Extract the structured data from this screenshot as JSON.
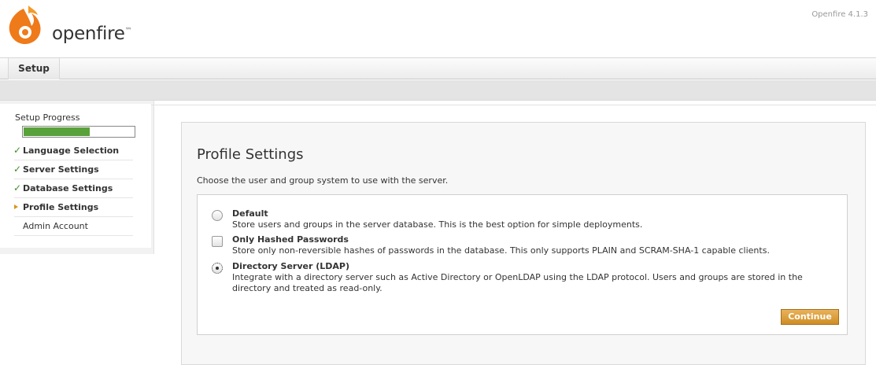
{
  "header": {
    "logo_text": "openfire",
    "logo_tm": "™",
    "version": "Openfire 4.1.3"
  },
  "tabs": {
    "setup_label": "Setup"
  },
  "sidebar": {
    "progress_label": "Setup Progress",
    "progress_fraction": 0.6,
    "items": [
      {
        "label": "Language Selection",
        "state": "done"
      },
      {
        "label": "Server Settings",
        "state": "done"
      },
      {
        "label": "Database Settings",
        "state": "done"
      },
      {
        "label": "Profile Settings",
        "state": "current"
      },
      {
        "label": "Admin Account",
        "state": "pending"
      }
    ]
  },
  "main": {
    "title": "Profile Settings",
    "intro": "Choose the user and group system to use with the server.",
    "options": [
      {
        "title": "Default",
        "description": "Store users and groups in the server database. This is the best option for simple deployments.",
        "selected": false
      },
      {
        "title": "Only Hashed Passwords",
        "description": "Store only non-reversible hashes of passwords in the database. This only supports PLAIN and SCRAM-SHA-1 capable clients.",
        "selected": false
      },
      {
        "title": "Directory Server (LDAP)",
        "description": "Integrate with a directory server such as Active Directory or OpenLDAP using the LDAP protocol. Users and groups are stored in the directory and treated as read-only.",
        "selected": true
      }
    ],
    "continue_label": "Continue"
  },
  "colors": {
    "progress": "#59a23b",
    "button": "#d99a35",
    "check": "#3d8f2b",
    "current_arrow": "#d9951c"
  }
}
